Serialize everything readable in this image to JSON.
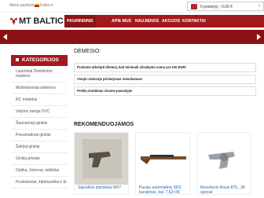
{
  "topbar": {
    "account": "Mano paskyra ▾",
    "language": "Kalba ▾",
    "cart_text": "0 prekė(s) - 0,00 €",
    "cart_arrow": "›"
  },
  "brand": {
    "name": "MT BALTIC",
    "logo_color": "#a31a1c"
  },
  "nav": [
    "PAGRINDINIS",
    "APIE MUS",
    "NAUJIENOS",
    "AKCIJOS",
    "KONTAKTAI"
  ],
  "sidebar": {
    "heading": "KATEGORIJOS",
    "items": [
      "Lazeriniai Ženklinimo mašinos",
      "Multirotoriniai sistemos",
      "RC modeliai",
      "Valymo įranga DVC",
      "Šaunamieji ginklai",
      "Pneumatiniai ginklai",
      "Šalt|eji ginklai",
      "Ginklų priedai",
      "Optika, žiūronai, taikikliai",
      "Prožektoriai, žibintuvėliai ir kt."
    ]
  },
  "main": {
    "title": "DĖMESIO:",
    "notices": [
      "Prašome atkreipti dėmesį, kad minimali užsakymo suma yra 100 EUR!",
      "Visoje Lietuvoje pristatymas nemokamas!",
      "Prekių siuntimas visame pasaulyje!"
    ],
    "recommended_title": "REKOMENDUOJAMOS"
  },
  "products": [
    {
      "name": "Signalinis pistoletas M57"
    },
    {
      "name": "Pusiau automatinis SKS karabinas, kal. 7,62×39"
    },
    {
      "name": "Revolveris Rossi 875, .38 special"
    }
  ]
}
